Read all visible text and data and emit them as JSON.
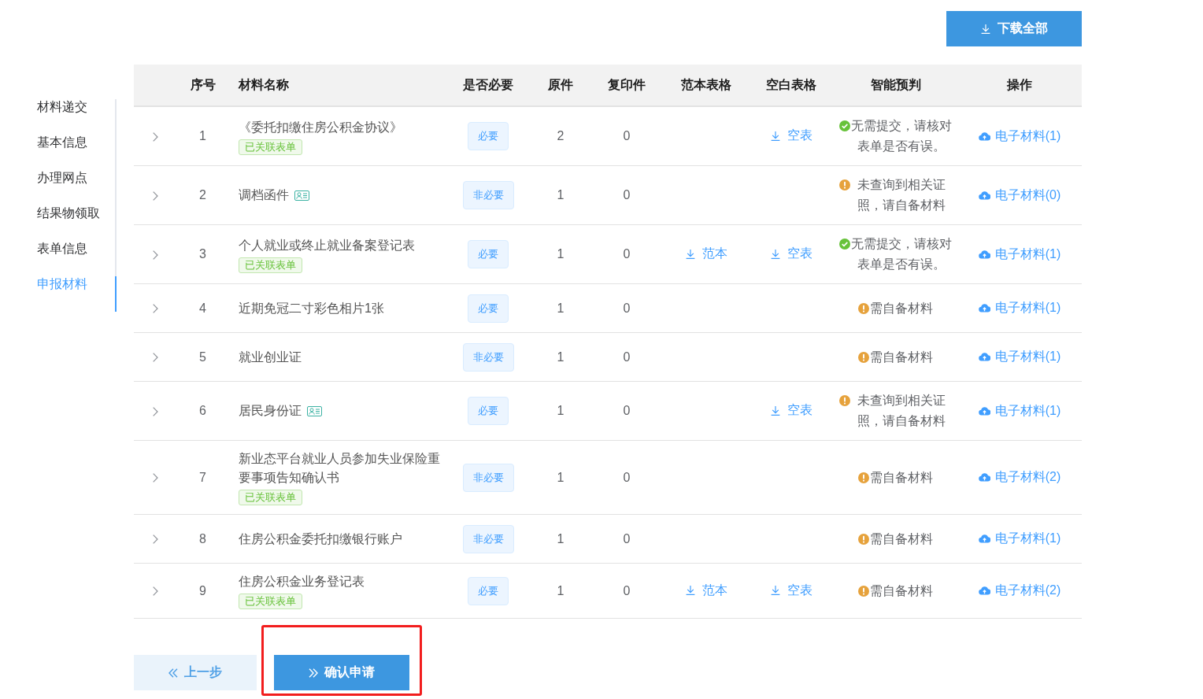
{
  "top_bar": {
    "download_all_button": "下载全部"
  },
  "sidebar": {
    "items": [
      {
        "label": "材料递交",
        "selected": false
      },
      {
        "label": "基本信息",
        "selected": false
      },
      {
        "label": "办理网点",
        "selected": false
      },
      {
        "label": "结果物领取",
        "selected": false
      },
      {
        "label": "表单信息",
        "selected": false
      },
      {
        "label": "申报材料",
        "selected": true
      }
    ]
  },
  "table": {
    "columns": [
      "序号",
      "材料名称",
      "是否必要",
      "原件",
      "复印件",
      "范本表格",
      "空白表格",
      "智能预判",
      "操作"
    ],
    "rows": [
      {
        "expanded": false,
        "index": "1",
        "name": "《委托扣缴住房公积金协议》",
        "id_card": false,
        "linked_tag": "已关联表单",
        "necessity": "必要",
        "originals": "2",
        "copies": "0",
        "blank_form": "空表",
        "prediction": {
          "kind": "ok",
          "text": "无需提交，请核对表单是否有误。"
        },
        "action": "电子材料(1)"
      },
      {
        "expanded": false,
        "index": "2",
        "name": "调档函件",
        "id_card": true,
        "necessity": "非必要",
        "originals": "1",
        "copies": "0",
        "prediction": {
          "kind": "warn",
          "text": "未查询到相关证照，请自备材料"
        },
        "action": "电子材料(0)"
      },
      {
        "expanded": false,
        "index": "3",
        "name": "个人就业或终止就业备案登记表",
        "id_card": false,
        "linked_tag": "已关联表单",
        "necessity": "必要",
        "originals": "1",
        "copies": "0",
        "sample_form": "范本",
        "blank_form": "空表",
        "prediction": {
          "kind": "ok",
          "text": "无需提交，请核对表单是否有误。"
        },
        "action": "电子材料(1)"
      },
      {
        "expanded": false,
        "index": "4",
        "name": "近期免冠二寸彩色相片1张",
        "id_card": false,
        "necessity": "必要",
        "originals": "1",
        "copies": "0",
        "prediction": {
          "kind": "warn",
          "text": "需自备材料"
        },
        "action": "电子材料(1)"
      },
      {
        "expanded": false,
        "index": "5",
        "name": "就业创业证",
        "id_card": false,
        "necessity": "非必要",
        "originals": "1",
        "copies": "0",
        "prediction": {
          "kind": "warn",
          "text": "需自备材料"
        },
        "action": "电子材料(1)"
      },
      {
        "expanded": false,
        "index": "6",
        "name": "居民身份证",
        "id_card": true,
        "necessity": "必要",
        "originals": "1",
        "copies": "0",
        "blank_form": "空表",
        "prediction": {
          "kind": "warn",
          "text": "未查询到相关证照，请自备材料"
        },
        "action": "电子材料(1)"
      },
      {
        "expanded": false,
        "index": "7",
        "name": "新业态平台就业人员参加失业保险重要事项告知确认书",
        "id_card": false,
        "linked_tag": "已关联表单",
        "necessity": "非必要",
        "originals": "1",
        "copies": "0",
        "prediction": {
          "kind": "warn",
          "text": "需自备材料"
        },
        "action": "电子材料(2)"
      },
      {
        "expanded": false,
        "index": "8",
        "name": "住房公积金委托扣缴银行账户",
        "id_card": false,
        "necessity": "非必要",
        "originals": "1",
        "copies": "0",
        "prediction": {
          "kind": "warn",
          "text": "需自备材料"
        },
        "action": "电子材料(1)"
      },
      {
        "expanded": false,
        "index": "9",
        "name": "住房公积金业务登记表",
        "id_card": false,
        "linked_tag": "已关联表单",
        "necessity": "必要",
        "originals": "1",
        "copies": "0",
        "sample_form": "范本",
        "blank_form": "空表",
        "prediction": {
          "kind": "warn",
          "text": "需自备材料"
        },
        "action": "电子材料(2)"
      }
    ]
  },
  "actions": {
    "previous_button": "上一步",
    "confirm_button": {
      "label": "确认申请",
      "highlighted": true
    }
  }
}
